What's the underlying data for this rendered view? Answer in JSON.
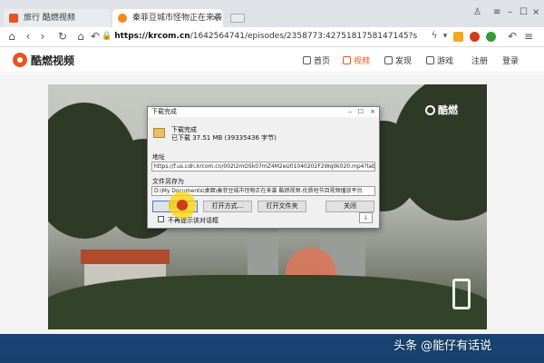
{
  "browser": {
    "tabs": [
      {
        "label": "旅行 酷燃视频"
      },
      {
        "label": "秦菲豆城市怪物正在来袭 酷"
      }
    ],
    "address": {
      "host": "https://krcom.cn",
      "path": "/1642564741/episodes/2358773:4275181758147145?s"
    }
  },
  "site": {
    "logo_text": "酷燃视频",
    "nav": [
      {
        "label": "首页"
      },
      {
        "label": "视频"
      },
      {
        "label": "发现"
      },
      {
        "label": "游戏"
      },
      {
        "label": "注册"
      },
      {
        "label": "登录"
      }
    ],
    "watermark": "酷燃"
  },
  "dialog": {
    "title": "下载完成",
    "heading": "下载完成",
    "downloaded": "已下载 37.51 MB (39335436 字节)",
    "address_label": "地址",
    "address_value": "https://f.us.cdn.krcom.cn/002I2mO5k07mZ4M2eU01040202F2Wq0k020.mp4?label=mp4",
    "save_as_label": "文件另存为",
    "save_as_value": "D:\\My Documents\\桌面\\秦菲豆城市怪物正在来袭 酷燃视频-优质短节目视频播放平台",
    "buttons": {
      "open": "打开",
      "open_with": "打开方式...",
      "open_folder": "打开文件夹",
      "close": "关闭"
    },
    "checkbox_label": "不再提示该对话框"
  },
  "footer": {
    "watermark": "头条 @能仔有话说"
  },
  "colors": {
    "accent": "#e8541d",
    "desktop": "#1e4f86",
    "link_blue": "#3b7bd2"
  }
}
